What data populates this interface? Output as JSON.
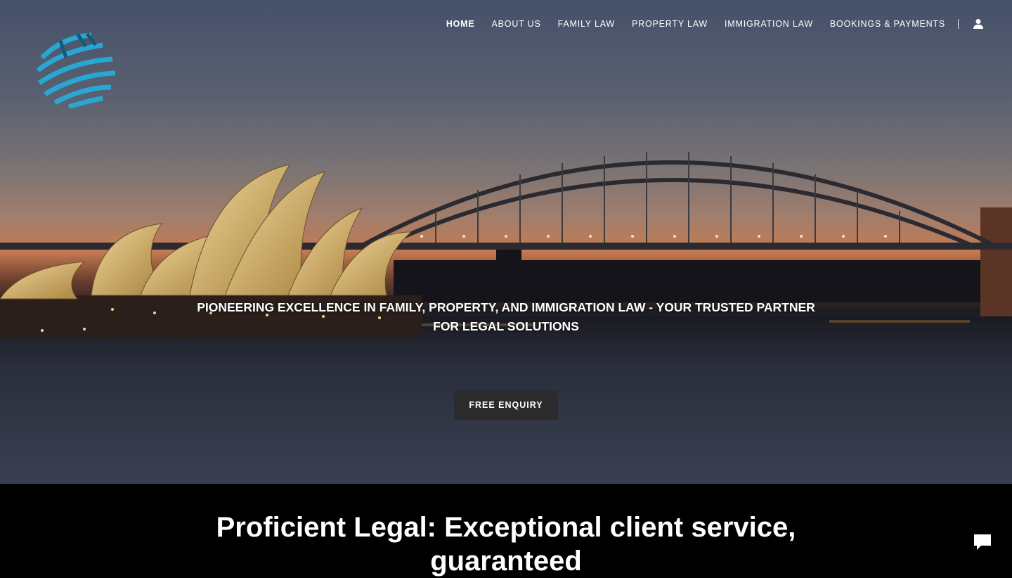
{
  "nav": {
    "items": [
      {
        "label": "HOME",
        "active": true
      },
      {
        "label": "ABOUT US",
        "active": false
      },
      {
        "label": "FAMILY LAW",
        "active": false
      },
      {
        "label": "PROPERTY LAW",
        "active": false
      },
      {
        "label": "IMMIGRATION LAW",
        "active": false
      },
      {
        "label": "BOOKINGS & PAYMENTS",
        "active": false
      }
    ],
    "account_icon": "user-icon"
  },
  "logo": {
    "icon": "globe-logo",
    "color": "#29a7d3"
  },
  "hero": {
    "tagline": "PIONEERING EXCELLENCE IN FAMILY, PROPERTY, AND IMMIGRATION LAW - YOUR TRUSTED PARTNER FOR LEGAL SOLUTIONS",
    "cta_label": "FREE ENQUIRY",
    "background": "Sydney Harbour at dusk"
  },
  "section": {
    "headline": "Proficient Legal: Exceptional client service, guaranteed"
  },
  "chat": {
    "icon": "chat-icon"
  }
}
